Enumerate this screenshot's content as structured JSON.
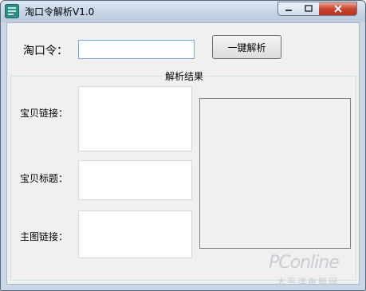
{
  "window": {
    "title": "淘口令解析V1.0"
  },
  "controls": {
    "input_label": "淘口令：",
    "input_value": "",
    "parse_button": "一键解析"
  },
  "result": {
    "group_title": "解析结果",
    "fields": [
      {
        "label": "宝贝链接：",
        "value": ""
      },
      {
        "label": "宝贝标题：",
        "value": ""
      },
      {
        "label": "主图链接：",
        "value": ""
      }
    ]
  },
  "watermark": {
    "brand": "PConline",
    "sub": "太平洋电脑网"
  },
  "colors": {
    "titlebar": "#c6d5e6",
    "close_button": "#c9452e",
    "client_bg": "#f0f0f0",
    "input_border": "#7aa7d8"
  },
  "icons": [
    "app-icon",
    "minimize-icon",
    "maximize-icon",
    "close-icon"
  ]
}
